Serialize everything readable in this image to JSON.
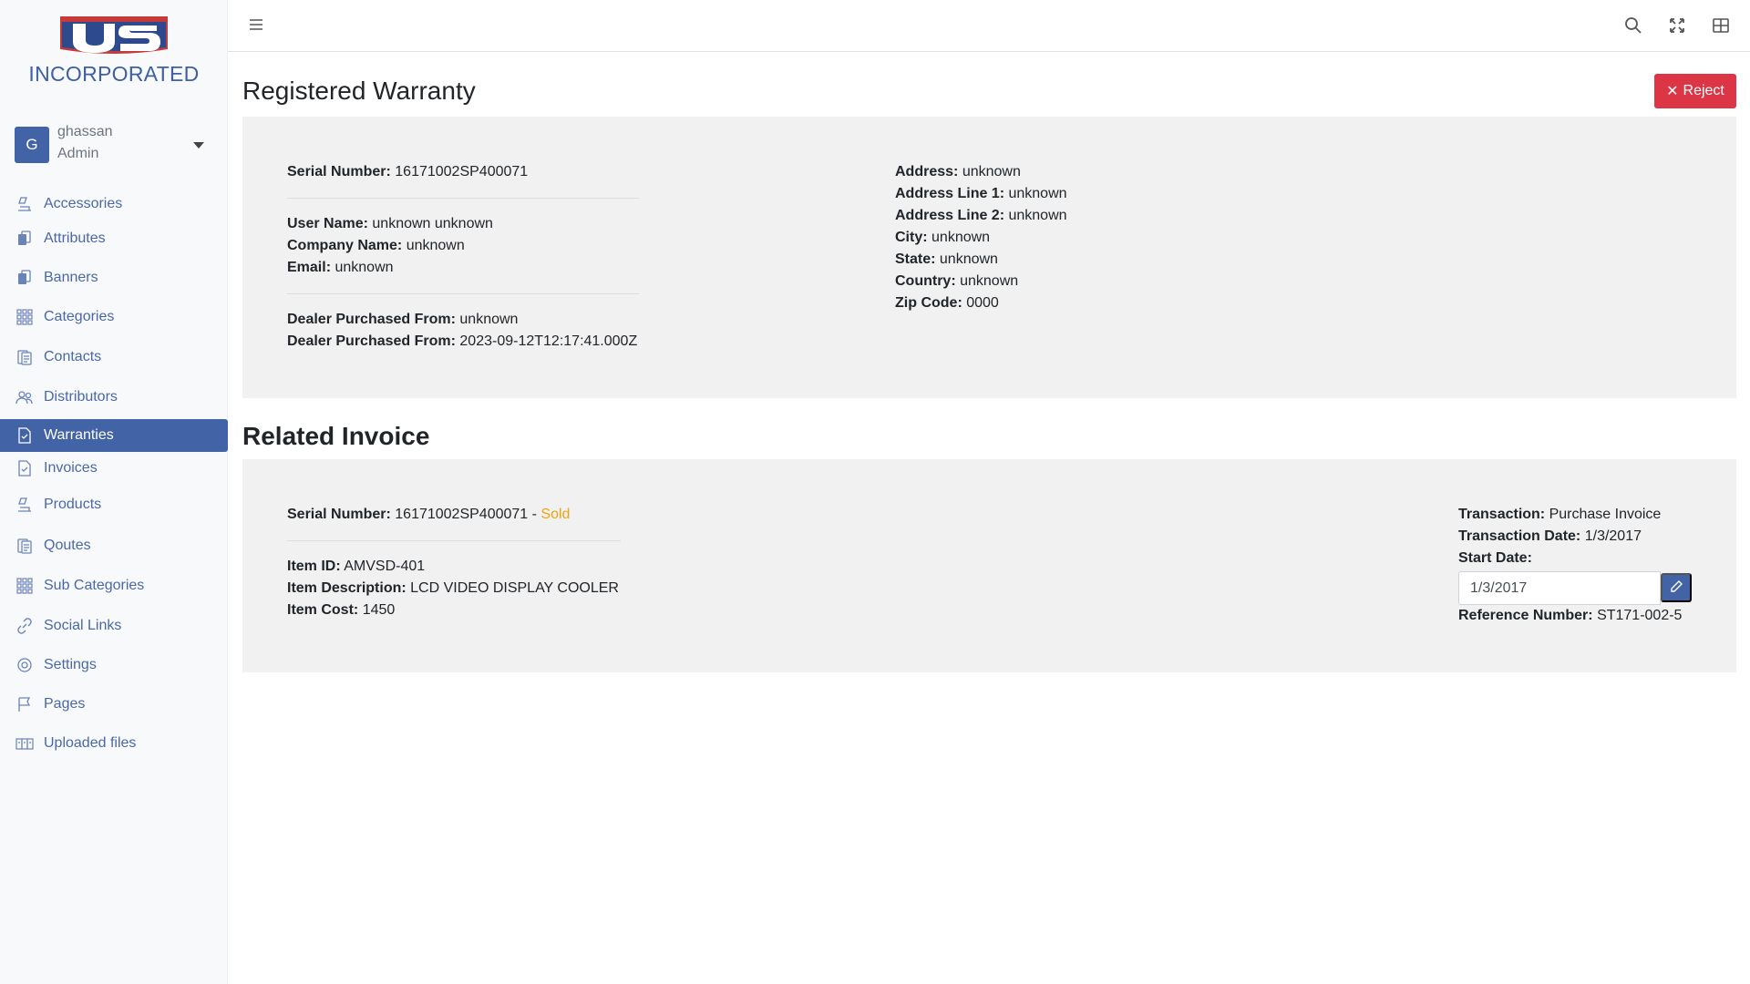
{
  "brand": {
    "logo_letters": "US",
    "name": "INCORPORATED"
  },
  "user": {
    "initial": "G",
    "name": "ghassan",
    "role": "Admin"
  },
  "sidebar": {
    "items": [
      {
        "label": "Accessories",
        "icon": "accessories-icon"
      },
      {
        "label": "Attributes",
        "icon": "copy-icon"
      },
      {
        "label": "Banners",
        "icon": "copy-icon"
      },
      {
        "label": "Categories",
        "icon": "grid-icon"
      },
      {
        "label": "Contacts",
        "icon": "documents-icon"
      },
      {
        "label": "Distributors",
        "icon": "people-icon"
      },
      {
        "label": "Warranties",
        "icon": "file-check-icon",
        "active": true
      },
      {
        "label": "Invoices",
        "icon": "file-check-icon"
      },
      {
        "label": "Products",
        "icon": "accessories-icon"
      },
      {
        "label": "Qoutes",
        "icon": "documents-icon"
      },
      {
        "label": "Sub Categories",
        "icon": "grid-icon"
      },
      {
        "label": "Social Links",
        "icon": "link-icon"
      },
      {
        "label": "Settings",
        "icon": "gear-icon"
      },
      {
        "label": "Pages",
        "icon": "flag-icon"
      },
      {
        "label": "Uploaded files",
        "icon": "files-icon"
      }
    ]
  },
  "topbar": {
    "icons": [
      "menu-icon",
      "search-icon",
      "fullscreen-icon",
      "layout-icon"
    ]
  },
  "header": {
    "title": "Registered Warranty",
    "reject_label": "Reject"
  },
  "warranty": {
    "serial_label": "Serial Number:",
    "serial": "16171002SP400071",
    "user_name_label": "User Name:",
    "user_name": "unknown unknown",
    "company_label": "Company Name:",
    "company": "unknown",
    "email_label": "Email:",
    "email": "unknown",
    "dealer_label": "Dealer Purchased From:",
    "dealer": "unknown",
    "dealer2_label": "Dealer Purchased From:",
    "dealer2": "2023-09-12T12:17:41.000Z",
    "address_label": "Address:",
    "address": "unknown",
    "address1_label": "Address Line 1:",
    "address1": "unknown",
    "address2_label": "Address Line 2:",
    "address2": "unknown",
    "city_label": "City:",
    "city": "unknown",
    "state_label": "State:",
    "state": "unknown",
    "country_label": "Country:",
    "country": "unknown",
    "zip_label": "Zip Code:",
    "zip": "0000"
  },
  "invoice": {
    "section_title": "Related Invoice",
    "serial_label": "Serial Number:",
    "serial": "16171002SP400071",
    "separator": " - ",
    "status": "Sold",
    "item_id_label": "Item ID:",
    "item_id": "AMVSD-401",
    "item_desc_label": "Item Description:",
    "item_desc": "LCD VIDEO DISPLAY COOLER",
    "item_cost_label": "Item Cost:",
    "item_cost": "1450",
    "transaction_label": "Transaction:",
    "transaction": "Purchase Invoice",
    "transaction_date_label": "Transaction Date:",
    "transaction_date": "1/3/2017",
    "start_date_label": "Start Date:",
    "start_date_value": "1/3/2017",
    "reference_label": "Reference Number:",
    "reference": "ST171-002-5"
  },
  "colors": {
    "brand_blue": "#4363a7",
    "danger": "#dc3545",
    "sold": "#f0a30a"
  }
}
